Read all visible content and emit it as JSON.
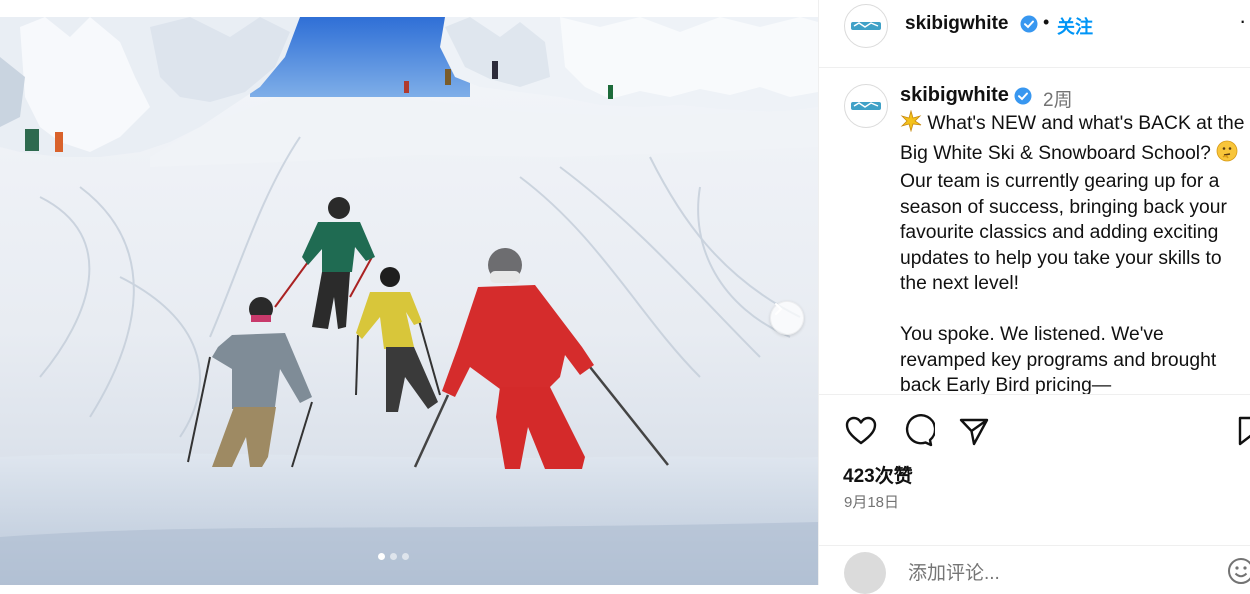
{
  "post": {
    "username": "skibigwhite",
    "follow_label": "关注",
    "separator": "•",
    "more_label": "···",
    "caption": {
      "username": "skibigwhite",
      "time_ago": "2周",
      "lines": [
        " What's NEW and what's BACK at the Big White Ski & Snowboard School? ",
        " Our team is currently gearing up for a season of success, bringing back your favourite classics and adding exciting updates to help you take your skills to the next level!",
        "You spoke. We listened. We've revamped key programs and brought back Early Bird pricing—"
      ]
    },
    "likes_label": "423次赞",
    "date_label": "9月18日",
    "comment": {
      "placeholder": "添加评论..."
    }
  },
  "carousel": {
    "total": 3,
    "active_index": 0
  },
  "icons": {
    "heart": "heart-icon",
    "comment": "comment-icon",
    "share": "share-icon",
    "save": "bookmark-icon",
    "verified": "verified-badge-icon",
    "next": "chevron-right-icon",
    "emoji": "emoji-icon"
  },
  "colors": {
    "link": "#0095f6",
    "verified": "#3897f0",
    "muted": "#737373",
    "divider": "#efefef"
  }
}
